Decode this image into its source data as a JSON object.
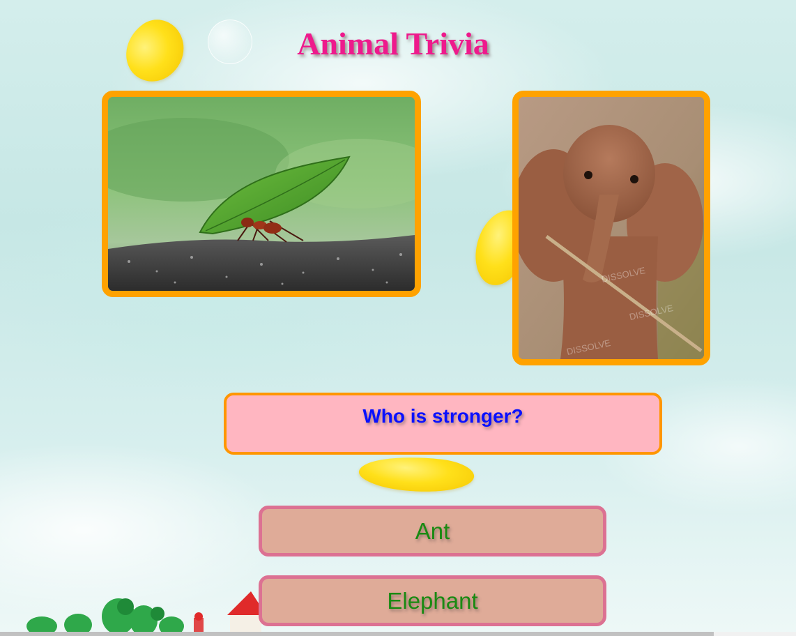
{
  "page": {
    "title": "Animal Trivia"
  },
  "images": [
    {
      "name": "ant-carrying-leaf-photo",
      "subject": "ant"
    },
    {
      "name": "baby-elephant-photo",
      "subject": "elephant",
      "watermark": "DISSOLVE"
    }
  ],
  "question": {
    "text": "Who is stronger?"
  },
  "answers": [
    {
      "label": "Ant"
    },
    {
      "label": "Elephant"
    }
  ],
  "colors": {
    "title": "#ee1a8c",
    "frame": "#ffa200",
    "question_bg": "#ffb6c1",
    "question_text": "#0a10ff",
    "answer_bg": "#dfab98",
    "answer_border": "#dc7192",
    "answer_text": "#1a8a12"
  }
}
